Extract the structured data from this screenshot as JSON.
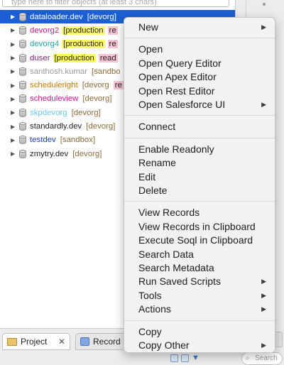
{
  "filter": {
    "placeholder": "type here to filter objects (at least 3 chars)"
  },
  "tree": {
    "items": [
      {
        "name": "dataloader.dev",
        "tag": "[devorg]",
        "selected": true
      },
      {
        "name": "devorg2",
        "tag": "[production",
        "tag2": "re",
        "name_color": "#c2188c",
        "tag_bg": "#ffff66",
        "tag2_bg": "#f6c4d2"
      },
      {
        "name": "devorg4",
        "tag": "[production",
        "tag2": "re",
        "name_color": "#1aa8a8",
        "tag_bg": "#ffff66",
        "tag2_bg": "#f6c4d2"
      },
      {
        "name": "duser",
        "tag": "[production",
        "tag2": "read",
        "name_color": "#7a1f6e",
        "tag_bg": "#ffff66",
        "tag2_bg": "#f6c4d2"
      },
      {
        "name": "santhosh.kumar",
        "tag": "[sandbo",
        "name_color": "#9a9a9a",
        "tag_color": "#8a6d3b"
      },
      {
        "name": "scheduleright",
        "tag": "[devorg",
        "tag2": "re",
        "name_color": "#c87800",
        "tag_color": "#8a6d3b",
        "tag2_bg": "#f6c4d2"
      },
      {
        "name": "scheduleview",
        "tag": "[devorg]",
        "name_color": "#c2188c",
        "tag_color": "#8a6d3b"
      },
      {
        "name": "skpdevorg",
        "tag": "[devorg]",
        "name_color": "#6cc9e8",
        "tag_color": "#8a6d3b"
      },
      {
        "name": "standardly.dev",
        "tag": "[devorg]",
        "name_color": "#222222",
        "tag_color": "#8a6d3b"
      },
      {
        "name": "testdev",
        "tag": "[sandbox]",
        "name_color": "#1f3fb0",
        "tag_color": "#8a6d3b"
      },
      {
        "name": "zmytry.dev",
        "tag": "[devorg]",
        "name_color": "#222222",
        "tag_color": "#8a6d3b"
      }
    ]
  },
  "tabs": {
    "project_label": "Project",
    "records_label": "Record"
  },
  "right_panel": {
    "search_placeholder": "Search"
  },
  "menu": {
    "groups": [
      [
        {
          "label": "New",
          "submenu": true
        }
      ],
      [
        {
          "label": "Open"
        },
        {
          "label": "Open Query Editor"
        },
        {
          "label": "Open Apex Editor"
        },
        {
          "label": "Open Rest Editor"
        },
        {
          "label": "Open Salesforce UI",
          "submenu": true
        }
      ],
      [
        {
          "label": "Connect"
        }
      ],
      [
        {
          "label": "Enable Readonly"
        },
        {
          "label": "Rename"
        },
        {
          "label": "Edit"
        },
        {
          "label": "Delete"
        }
      ],
      [
        {
          "label": "View Records"
        },
        {
          "label": "View Records in Clipboard"
        },
        {
          "label": "Execute Soql in Clipboard"
        },
        {
          "label": "Search Data"
        },
        {
          "label": "Search Metadata"
        },
        {
          "label": "Run Saved Scripts",
          "submenu": true
        },
        {
          "label": "Tools",
          "submenu": true
        },
        {
          "label": "Actions",
          "submenu": true
        }
      ],
      [
        {
          "label": "Copy"
        },
        {
          "label": "Copy Other",
          "submenu": true
        }
      ]
    ]
  },
  "colors": {
    "selection": "#1c5fd4",
    "production_highlight": "#ffff66",
    "readonly_highlight": "#f6c4d2"
  }
}
